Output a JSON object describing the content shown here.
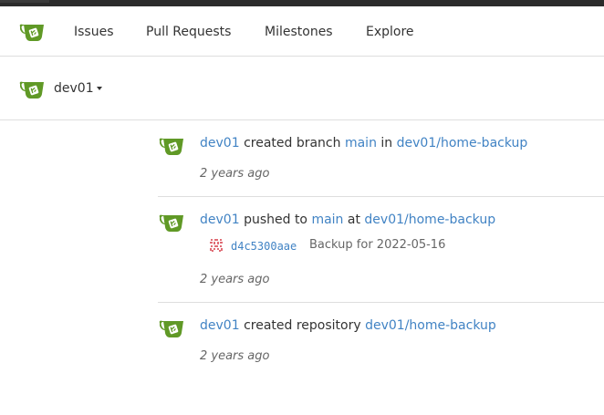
{
  "navbar": {
    "items": [
      {
        "label": "Issues"
      },
      {
        "label": "Pull Requests"
      },
      {
        "label": "Milestones"
      },
      {
        "label": "Explore"
      }
    ]
  },
  "context": {
    "user": "dev01"
  },
  "colors": {
    "brand": "#609926",
    "link": "#4183c4"
  },
  "icons": {
    "logo": "gitea-teacup-icon",
    "commit_avatar": "identicon"
  },
  "feed": [
    {
      "user": "dev01",
      "action": "created branch",
      "ref": "main",
      "prep": "in",
      "repo": "dev01/home-backup",
      "time": "2 years ago"
    },
    {
      "user": "dev01",
      "action": "pushed to",
      "ref": "main",
      "prep": "at",
      "repo": "dev01/home-backup",
      "commit": {
        "sha": "d4c5300aae",
        "message": "Backup for 2022-05-16"
      },
      "time": "2 years ago"
    },
    {
      "user": "dev01",
      "action": "created repository",
      "repo": "dev01/home-backup",
      "time": "2 years ago"
    }
  ]
}
